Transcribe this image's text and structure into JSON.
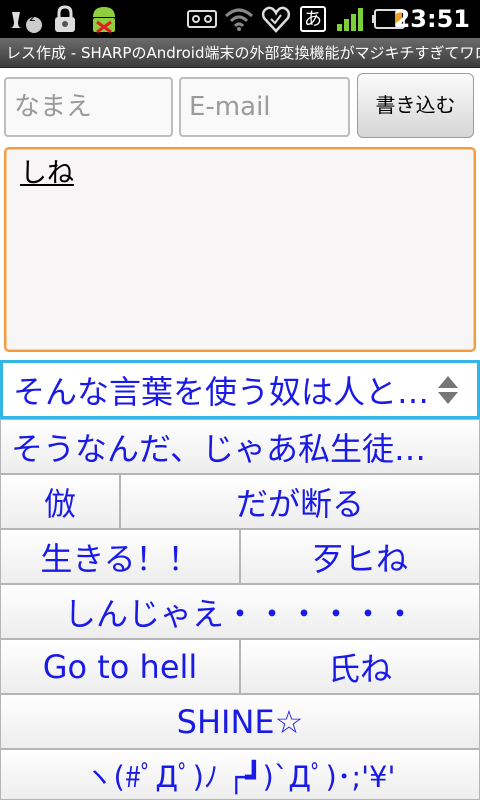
{
  "status_bar": {
    "notification_count": "2",
    "time": "23:51",
    "kana": "あ",
    "icons": [
      "notification-icon",
      "lock-icon",
      "android-debug-icon",
      "voicemail-icon",
      "wifi-icon",
      "heart-icon",
      "kana-input-icon",
      "signal-icon",
      "battery-icon"
    ]
  },
  "title_bar": {
    "title": "レス作成 - SHARPのAndroid端末の外部変換機能がマジキチすぎてワロタwww"
  },
  "form": {
    "name_placeholder": "なまえ",
    "email_placeholder": "E-mail",
    "submit_label": "書き込む",
    "body_text": "しね"
  },
  "candidates": {
    "rows": [
      {
        "items": [
          "そんな言葉を使う奴は人と…"
        ]
      },
      {
        "items": [
          "そうなんだ、じゃあ私生徒…"
        ]
      },
      {
        "items": [
          "倣",
          "だが断る"
        ]
      },
      {
        "items": [
          "生きる！！",
          "歹ヒね"
        ]
      },
      {
        "items": [
          "しんじゃえ・・・・・・"
        ]
      },
      {
        "items": [
          "Go to hell",
          "氏ね"
        ]
      },
      {
        "items": [
          "SHINE☆"
        ]
      },
      {
        "items": [
          "ヽ(#ﾟДﾟ)ﾉ ┌┛)`Дﾟ)･;'¥'"
        ]
      }
    ]
  },
  "colors": {
    "candidate_text": "#1a1ae6",
    "focus_border": "#f39b3a",
    "selection_border": "#33b5e5"
  }
}
